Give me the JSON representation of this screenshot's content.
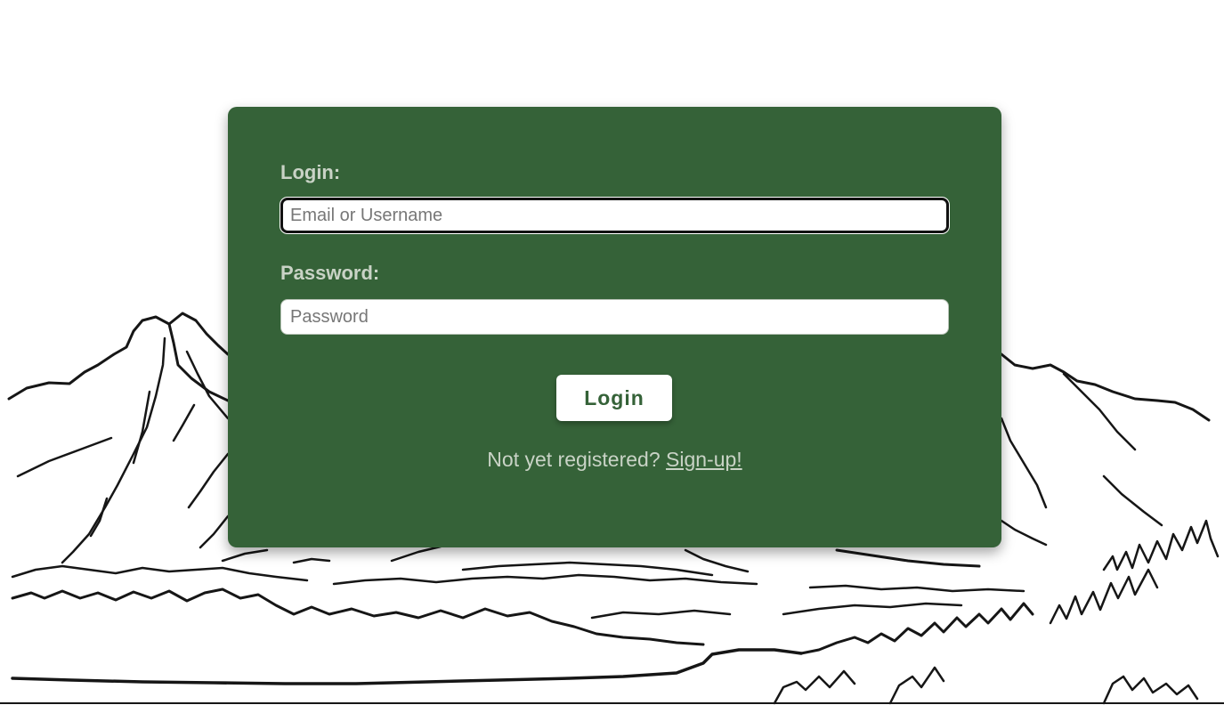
{
  "login_form": {
    "login_label": "Login:",
    "email_placeholder": "Email or Username",
    "email_value": "",
    "password_label": "Password:",
    "password_placeholder": "Password",
    "password_value": "",
    "submit_label": "Login",
    "register_prompt": "Not yet registered?",
    "signup_link": "Sign-up!"
  },
  "colors": {
    "card_background": "#356238",
    "label_text": "#c9d3c6",
    "button_background": "#ffffff",
    "button_text": "#356238"
  },
  "background": {
    "illustration": "mountain-lake-line-sketch"
  }
}
